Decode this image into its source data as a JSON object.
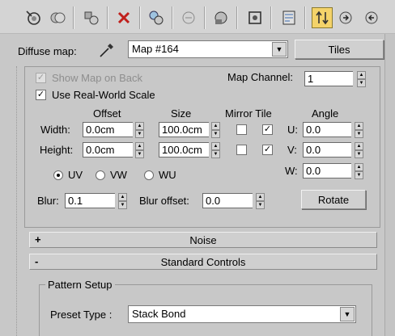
{
  "toolbar": {
    "buttons": [
      {
        "name": "sample-uv-icon"
      },
      {
        "name": "put-to-scene-icon"
      },
      {
        "name": "assign-to-selection-icon"
      },
      {
        "name": "reset-map-icon"
      },
      {
        "name": "make-unique-icon"
      },
      {
        "name": "put-to-library-icon"
      },
      {
        "name": "material-id-icon"
      },
      {
        "name": "show-shaded-icon"
      },
      {
        "name": "show-end-result-icon"
      },
      {
        "name": "go-to-parent-icon"
      },
      {
        "name": "go-forward-icon"
      },
      {
        "name": "go-sibling-icon"
      }
    ]
  },
  "map_row": {
    "label": "Diffuse map:",
    "map_name": "Map #164",
    "map_type": "Tiles"
  },
  "coordinates": {
    "show_map_on_back": "Show Map on Back",
    "real_world_scale": "Use Real-World Scale",
    "map_channel_label": "Map Channel:",
    "map_channel": "1",
    "headers": {
      "offset": "Offset",
      "size": "Size",
      "mirror_tile": "Mirror Tile",
      "angle": "Angle"
    },
    "width_label": "Width:",
    "height_label": "Height:",
    "width_offset": "0.0cm",
    "height_offset": "0.0cm",
    "width_size": "100.0cm",
    "height_size": "100.0cm",
    "u_label": "U:",
    "v_label": "V:",
    "w_label": "W:",
    "u_angle": "0.0",
    "v_angle": "0.0",
    "w_angle": "0.0",
    "radio_uv": "UV",
    "radio_vw": "VW",
    "radio_wu": "WU",
    "blur_label": "Blur:",
    "blur": "0.1",
    "blur_offset_label": "Blur offset:",
    "blur_offset": "0.0",
    "rotate": "Rotate"
  },
  "rollouts": {
    "noise_sign": "+",
    "noise": "Noise",
    "standard_sign": "-",
    "standard": "Standard Controls"
  },
  "pattern": {
    "group_title": "Pattern Setup",
    "preset_label": "Preset Type :",
    "preset_value": "Stack Bond"
  }
}
